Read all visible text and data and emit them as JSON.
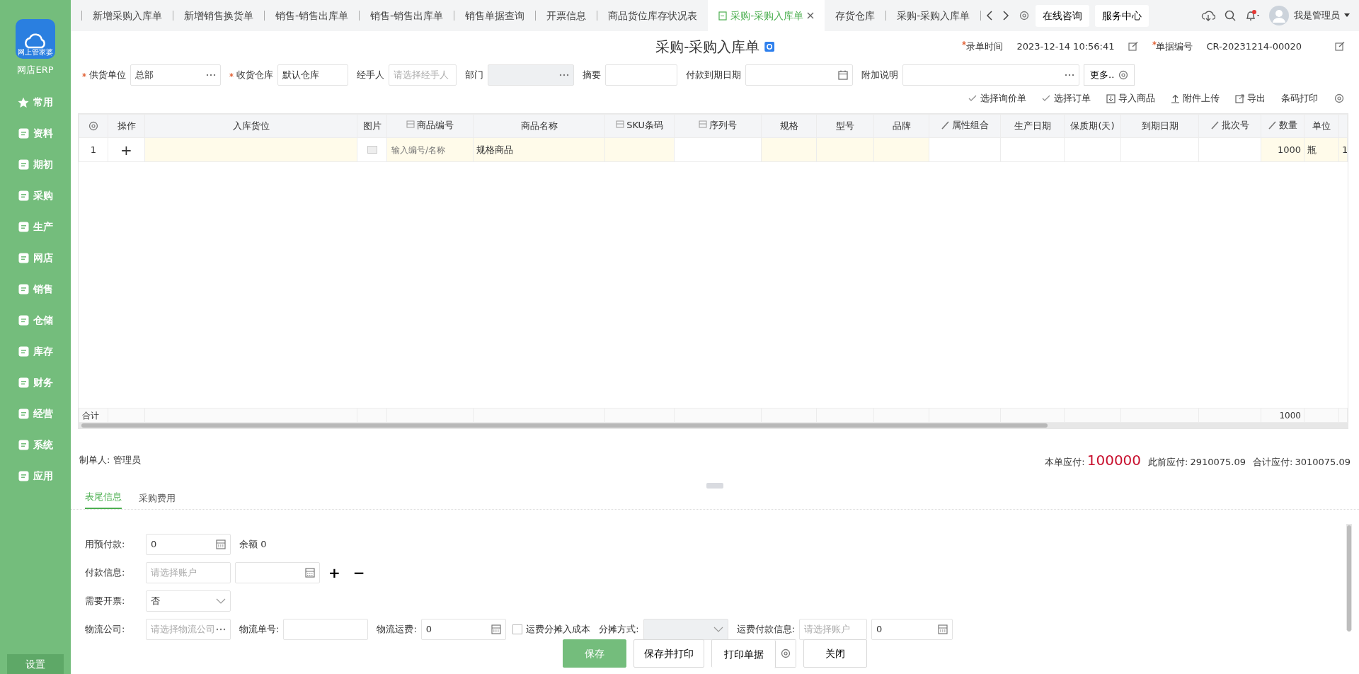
{
  "sidebar": {
    "logo_caption": "网上管家婆",
    "app_name": "网店ERP",
    "items": [
      {
        "label": "常用"
      },
      {
        "label": "资料"
      },
      {
        "label": "期初"
      },
      {
        "label": "采购"
      },
      {
        "label": "生产"
      },
      {
        "label": "网店"
      },
      {
        "label": "销售"
      },
      {
        "label": "仓储"
      },
      {
        "label": "库存"
      },
      {
        "label": "财务"
      },
      {
        "label": "经营"
      },
      {
        "label": "系统"
      },
      {
        "label": "应用"
      }
    ],
    "settings": "设置"
  },
  "tabs": [
    {
      "label": "新增采购入库单",
      "selected": false
    },
    {
      "label": "新增销售换货单",
      "selected": false
    },
    {
      "label": "销售-销售出库单",
      "selected": false
    },
    {
      "label": "销售-销售出库单",
      "selected": false
    },
    {
      "label": "销售单据查询",
      "selected": false
    },
    {
      "label": "开票信息",
      "selected": false
    },
    {
      "label": "商品货位库存状况表",
      "selected": false
    },
    {
      "label": "采购-采购入库单",
      "selected": true
    },
    {
      "label": "存货仓库",
      "selected": false
    },
    {
      "label": "采购-采购入库单",
      "selected": false
    }
  ],
  "header_links": [
    "在线咨询",
    "服务中心"
  ],
  "notifications": {
    "unread": true
  },
  "user": {
    "name": "我是管理员"
  },
  "form": {
    "title": "采购-采购入库单",
    "meta": [
      {
        "label": "录单时间",
        "value": "2023-12-14 10:56:41",
        "required": true
      },
      {
        "label": "单据编号",
        "value": "CR-20231214-00020",
        "required": true
      }
    ],
    "fields": [
      {
        "label": "供货单位",
        "required": true,
        "kind": "picker",
        "value": "总部"
      },
      {
        "label": "收货仓库",
        "required": true,
        "kind": "input",
        "value": "默认仓库"
      },
      {
        "label": "经手人",
        "kind": "input",
        "placeholder": "请选择经手人"
      },
      {
        "label": "部门",
        "kind": "picker",
        "disabled": true
      },
      {
        "label": "摘要",
        "kind": "input"
      },
      {
        "label": "付款到期日期",
        "kind": "date"
      },
      {
        "label": "附加说明",
        "kind": "picker"
      }
    ],
    "more_button": "更多.."
  },
  "toolbar": [
    {
      "label": "选择询价单",
      "kind": "check"
    },
    {
      "label": "选择订单",
      "kind": "check"
    },
    {
      "label": "导入商品",
      "kind": "import"
    },
    {
      "label": "附件上传",
      "kind": "upload"
    },
    {
      "label": "导出",
      "kind": "export"
    },
    {
      "label": "条码打印",
      "kind": "plain"
    }
  ],
  "table": {
    "columns": [
      {
        "kind": "settings"
      },
      {
        "label": "操作",
        "kind": "plain"
      },
      {
        "label": "入库货位",
        "kind": "plain"
      },
      {
        "label": "图片",
        "kind": "plain"
      },
      {
        "label": "商品编号",
        "kind": "lookup"
      },
      {
        "label": "商品名称",
        "kind": "plain"
      },
      {
        "label": "SKU条码",
        "kind": "lookup"
      },
      {
        "label": "序列号",
        "kind": "lookup"
      },
      {
        "label": "规格",
        "kind": "plain"
      },
      {
        "label": "型号",
        "kind": "plain"
      },
      {
        "label": "品牌",
        "kind": "plain"
      },
      {
        "label": "属性组合",
        "kind": "edit"
      },
      {
        "label": "生产日期",
        "kind": "plain"
      },
      {
        "label": "保质期(天)",
        "kind": "plain"
      },
      {
        "label": "到期日期",
        "kind": "plain"
      },
      {
        "label": "批次号",
        "kind": "edit"
      },
      {
        "label": "数量",
        "kind": "edit",
        "total": "1000"
      },
      {
        "label": "单位",
        "kind": "plain"
      },
      {
        "kind": "plain"
      }
    ],
    "rows": [
      {
        "cells": [
          {
            "text": "1",
            "editable": false
          },
          {
            "text": "+",
            "editable": false
          },
          {
            "editable": true
          },
          {
            "kind": "image",
            "editable": false
          },
          {
            "placeholder": "输入编号/名称",
            "editable": true
          },
          {
            "text": "规格商品",
            "editable": true
          },
          {
            "editable": true
          },
          {
            "editable": false
          },
          {
            "editable": true
          },
          {
            "editable": true
          },
          {
            "editable": true
          },
          {
            "editable": false
          },
          {
            "editable": false
          },
          {
            "editable": false
          },
          {
            "editable": false
          },
          {
            "editable": false
          },
          {
            "text": "1000",
            "editable": true
          },
          {
            "text": "瓶",
            "editable": true
          },
          {
            "text": "1",
            "editable": true
          }
        ]
      }
    ],
    "totals_label": "合计"
  },
  "creator": "制单人: 管理员",
  "amounts": [
    {
      "label": "本单应付:",
      "value": "100000",
      "emphasis": true
    },
    {
      "label": "此前应付:",
      "value": "2910075.09",
      "emphasis": false
    },
    {
      "label": "合计应付:",
      "value": "3010075.09",
      "emphasis": false
    }
  ],
  "footer_tabs": [
    {
      "label": "表尾信息",
      "selected": true
    },
    {
      "label": "采购费用",
      "selected": false
    }
  ],
  "footer_form": [
    [
      {
        "kind": "label",
        "text": "用预付款:"
      },
      {
        "kind": "number",
        "value": "0"
      },
      {
        "kind": "text",
        "text": "余额 0"
      }
    ],
    [
      {
        "kind": "label",
        "text": "付款信息:"
      },
      {
        "kind": "input",
        "placeholder": "请选择账户"
      },
      {
        "kind": "number"
      },
      {
        "kind": "button",
        "text": "+"
      },
      {
        "kind": "button",
        "text": "−"
      }
    ],
    [
      {
        "kind": "label",
        "text": "需要开票:"
      },
      {
        "kind": "select",
        "value": "否"
      }
    ],
    [
      {
        "kind": "label",
        "text": "物流公司:"
      },
      {
        "kind": "picker",
        "placeholder": "请选择物流公司"
      },
      {
        "kind": "label",
        "text": "物流单号:"
      },
      {
        "kind": "input"
      },
      {
        "kind": "label",
        "text": "物流运费:"
      },
      {
        "kind": "number",
        "value": "0"
      },
      {
        "kind": "checkbox",
        "text": "运费分摊入成本",
        "checked": false
      },
      {
        "kind": "label",
        "text": "分摊方式:"
      },
      {
        "kind": "select",
        "disabled": true
      },
      {
        "kind": "label",
        "text": "运费付款信息:"
      },
      {
        "kind": "input",
        "placeholder": "请选择账户"
      },
      {
        "kind": "number",
        "value": "0"
      }
    ]
  ],
  "actions": [
    {
      "label": "保存",
      "kind": "primary"
    },
    {
      "label": "保存并打印",
      "kind": "default"
    },
    {
      "label": "打印单据",
      "kind": "split"
    },
    {
      "label": "关闭",
      "kind": "default"
    }
  ]
}
